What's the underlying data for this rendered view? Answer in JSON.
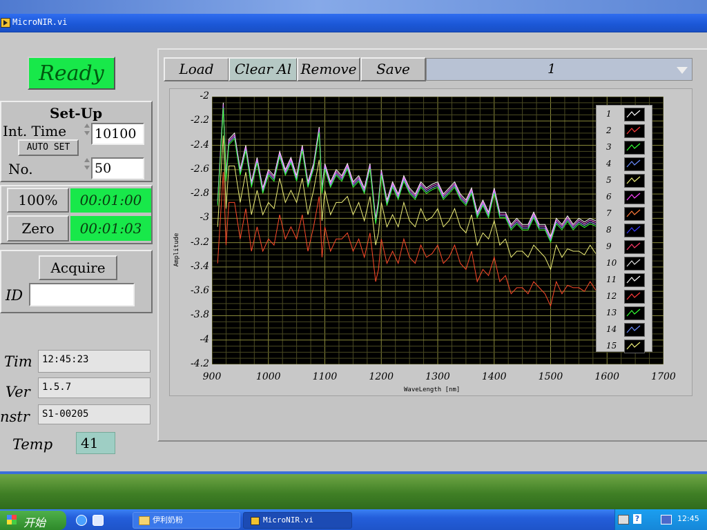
{
  "window": {
    "title": "MicroNIR.vi"
  },
  "status": {
    "label": "Ready",
    "color": "#18e84a"
  },
  "setup": {
    "title": "Set-Up",
    "int_time_label": "Int. Time",
    "int_time_value": "10100",
    "auto_set_label": "AUTO SET",
    "no_label": "No.",
    "no_value": "50"
  },
  "calibration": {
    "btn_100": "100%",
    "time_100": "00:01:00",
    "btn_zero": "Zero",
    "time_zero": "00:01:03"
  },
  "acquire": {
    "button": "Acquire",
    "id_label": "ID",
    "id_value": ""
  },
  "info": {
    "time_label": "Tim",
    "time_value": "12:45:23",
    "ver_label": "Ver",
    "ver_value": "1.5.7",
    "instr_label": "nstr",
    "instr_value": "S1-00205",
    "temp_label": "Temp",
    "temp_value": "41"
  },
  "toolbar": {
    "load": "Load",
    "clear_all": "Clear Al",
    "remove": "Remove",
    "save": "Save",
    "selector_value": "1"
  },
  "chart_data": {
    "type": "line",
    "xlabel": "WaveLength [nm]",
    "ylabel": "Amplitude",
    "xlim": [
      900,
      1700
    ],
    "ylim": [
      -4.2,
      -2
    ],
    "x_ticks": [
      "900",
      "1000",
      "1100",
      "1200",
      "1300",
      "1400",
      "1500",
      "1600",
      "1700"
    ],
    "y_ticks": [
      "-2",
      "-2.2",
      "-2.4",
      "-2.6",
      "-2.8",
      "-3",
      "-3.2",
      "-3.4",
      "-3.6",
      "-3.8",
      "-4",
      "-4.2"
    ],
    "grid": true,
    "legend": [
      "1",
      "2",
      "3",
      "4",
      "5",
      "6",
      "7",
      "8",
      "9",
      "10",
      "11",
      "12",
      "13",
      "14",
      "15"
    ],
    "legend_colors": [
      "#ffffff",
      "#ff3a3a",
      "#33ff33",
      "#6a8cff",
      "#f0f07a",
      "#ff44ff",
      "#ff7a3a",
      "#3a3aff",
      "#ff3a6a",
      "#e0e0e0",
      "#ffffff",
      "#ff3a3a",
      "#33ff33",
      "#6a8cff",
      "#f0f07a"
    ],
    "series": [
      {
        "name": "main",
        "color": "#ffffff",
        "x": [
          910,
          920,
          925,
          930,
          940,
          950,
          960,
          970,
          980,
          990,
          1000,
          1010,
          1020,
          1030,
          1040,
          1050,
          1060,
          1070,
          1080,
          1090,
          1095,
          1100,
          1110,
          1120,
          1130,
          1140,
          1150,
          1160,
          1170,
          1180,
          1190,
          1195,
          1200,
          1210,
          1220,
          1230,
          1240,
          1250,
          1260,
          1270,
          1280,
          1290,
          1300,
          1310,
          1320,
          1330,
          1340,
          1350,
          1360,
          1370,
          1380,
          1390,
          1400,
          1410,
          1420,
          1430,
          1440,
          1450,
          1460,
          1470,
          1480,
          1490,
          1500,
          1510,
          1520,
          1530,
          1540,
          1550,
          1560,
          1570,
          1580
        ],
        "y": [
          -2.85,
          -2.05,
          -2.65,
          -2.35,
          -2.3,
          -2.6,
          -2.4,
          -2.7,
          -2.5,
          -2.75,
          -2.6,
          -2.65,
          -2.45,
          -2.6,
          -2.5,
          -2.65,
          -2.4,
          -2.7,
          -2.55,
          -2.25,
          -2.75,
          -2.55,
          -2.7,
          -2.6,
          -2.65,
          -2.55,
          -2.7,
          -2.65,
          -2.75,
          -2.55,
          -3.0,
          -2.85,
          -2.6,
          -2.85,
          -2.7,
          -2.8,
          -2.65,
          -2.75,
          -2.8,
          -2.7,
          -2.75,
          -2.72,
          -2.7,
          -2.8,
          -2.75,
          -2.7,
          -2.8,
          -2.85,
          -2.75,
          -2.95,
          -2.85,
          -2.95,
          -2.75,
          -2.95,
          -2.95,
          -3.05,
          -3.0,
          -3.05,
          -3.05,
          -2.95,
          -3.05,
          -3.05,
          -3.15,
          -3.0,
          -3.05,
          -2.98,
          -3.05,
          -3.0,
          -3.03,
          -3.0,
          -3.02
        ]
      },
      {
        "name": "series-2",
        "color": "#f0f07a",
        "offset": -0.25
      },
      {
        "name": "series-3",
        "color": "#ff4a2a",
        "offset": -0.55
      }
    ]
  },
  "taskbar": {
    "start": "开始",
    "item1": "伊利奶粉",
    "item2": "MicroNIR.vi",
    "clock": "12:45"
  }
}
